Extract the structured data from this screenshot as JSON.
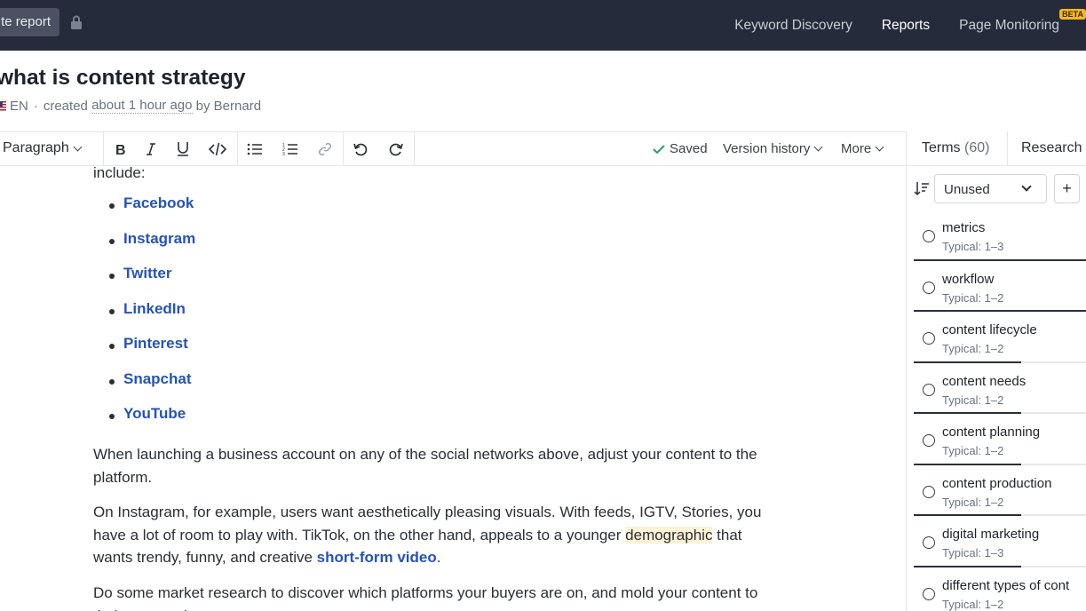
{
  "topnav": {
    "report_button": "te report",
    "links": [
      {
        "label": "Keyword Discovery"
      },
      {
        "label": "Reports"
      },
      {
        "label": "Page Monitoring"
      }
    ],
    "beta_badge": "BETA"
  },
  "header": {
    "title": "what is content strategy",
    "lang": "EN",
    "created_prefix": "created",
    "created_time": "about 1 hour ago",
    "created_by": "by Bernard"
  },
  "toolbar": {
    "paragraph_label": "Paragraph",
    "saved_label": "Saved",
    "version_history_label": "Version history",
    "more_label": "More"
  },
  "doc": {
    "intro_fragment": "include:",
    "bullets": [
      "Facebook",
      "Instagram",
      "Twitter",
      "LinkedIn",
      "Pinterest",
      "Snapchat",
      "YouTube"
    ],
    "para1": "When launching a business account on any of the social networks above, adjust your content to the platform.",
    "para2_a": "On Instagram, for example, users want aesthetically pleasing visuals. With feeds, IGTV, Stories, you have a lot of room to play with. TikTok, on the other hand, appeals to a younger ",
    "para2_highlight": "demographic",
    "para2_b": " that wants trendy, funny, and creative ",
    "para2_link": "short-form video",
    "para2_end": ".",
    "para3": "Do some market research to discover which platforms your buyers are on, and mold your content to their expectations."
  },
  "panel": {
    "tab_terms": "Terms",
    "tab_terms_count": "(60)",
    "tab_research": "Research",
    "filter_value": "Unused",
    "add_label": "+",
    "terms": [
      {
        "name": "metrics",
        "typical": "Typical: 1–3",
        "progress": 1.0
      },
      {
        "name": "workflow",
        "typical": "Typical: 1–2",
        "progress": 1.0
      },
      {
        "name": "content lifecycle",
        "typical": "Typical: 1–2",
        "progress": 0.62
      },
      {
        "name": "content needs",
        "typical": "Typical: 1–2",
        "progress": 0.62
      },
      {
        "name": "content planning",
        "typical": "Typical: 1–2",
        "progress": 0.62
      },
      {
        "name": "content production",
        "typical": "Typical: 1–2",
        "progress": 0.62
      },
      {
        "name": "digital marketing",
        "typical": "Typical: 1–3",
        "progress": 0.62
      },
      {
        "name": "different types of cont",
        "typical": "Typical: 1–2",
        "progress": 0.62
      }
    ]
  }
}
